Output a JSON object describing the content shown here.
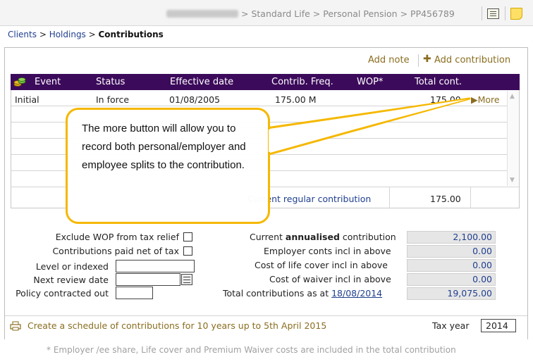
{
  "topbar": {
    "breadcrumb": "> Standard Life > Personal Pension > PP456789"
  },
  "breadcrumb": {
    "clients": "Clients",
    "sep1": " > ",
    "holdings": "Holdings",
    "sep2": " > ",
    "current": "Contributions"
  },
  "actions": {
    "add_note": "Add note",
    "add_contribution": "Add contribution"
  },
  "table": {
    "headers": {
      "event": "Event",
      "status": "Status",
      "effective_date": "Effective date",
      "contrib_freq": "Contrib. Freq.",
      "wop": "WOP*",
      "total_cont": "Total cont."
    },
    "rows": [
      {
        "event": "Initial",
        "status": "In force",
        "effective_date": "01/08/2005",
        "contrib_freq": "175.00 M",
        "wop": "",
        "total_cont": "175.00",
        "more": "More"
      }
    ],
    "current_regular_label": "Current regular contribution",
    "current_regular_value": "175.00"
  },
  "callout": {
    "text": "The more button will allow you to record both personal/employer and employee splits to the contribution."
  },
  "form_left": {
    "exclude_wop": "Exclude WOP from tax relief",
    "paid_net": "Contributions paid net of tax",
    "level_indexed": "Level or indexed",
    "next_review": "Next review date",
    "contracted_out": "Policy contracted out"
  },
  "form_right": {
    "annualised_pre": "Current ",
    "annualised_bold": "annualised",
    "annualised_post": " contribution",
    "annualised_value": "2,100.00",
    "employer_label": "Employer conts incl in above",
    "employer_value": "0.00",
    "life_label": "Cost of life cover incl in above",
    "life_value": "0.00",
    "waiver_label": "Cost of waiver incl in above",
    "waiver_value": "0.00",
    "total_label": "Total contributions as at ",
    "total_date": "18/08/2014",
    "total_value": "19,075.00"
  },
  "schedule": {
    "text": "Create a schedule of contributions for 10 years up to 5th April 2015",
    "tax_year_label": "Tax year",
    "tax_year_value": "2014"
  },
  "footnote": "* Employer /ee share, Life cover and Premium Waiver costs are included in the total contribution",
  "colors": {
    "header_purple": "#3c0a5b",
    "link_blue": "#1f3f8f",
    "action_gold": "#8a6d1f",
    "callout_yellow": "#f5b800"
  },
  "icons": [
    "notes-list-icon",
    "sticky-note-icon",
    "coins-icon",
    "more-arrow-icon",
    "calendar-icon",
    "print-icon",
    "plus-icon"
  ]
}
